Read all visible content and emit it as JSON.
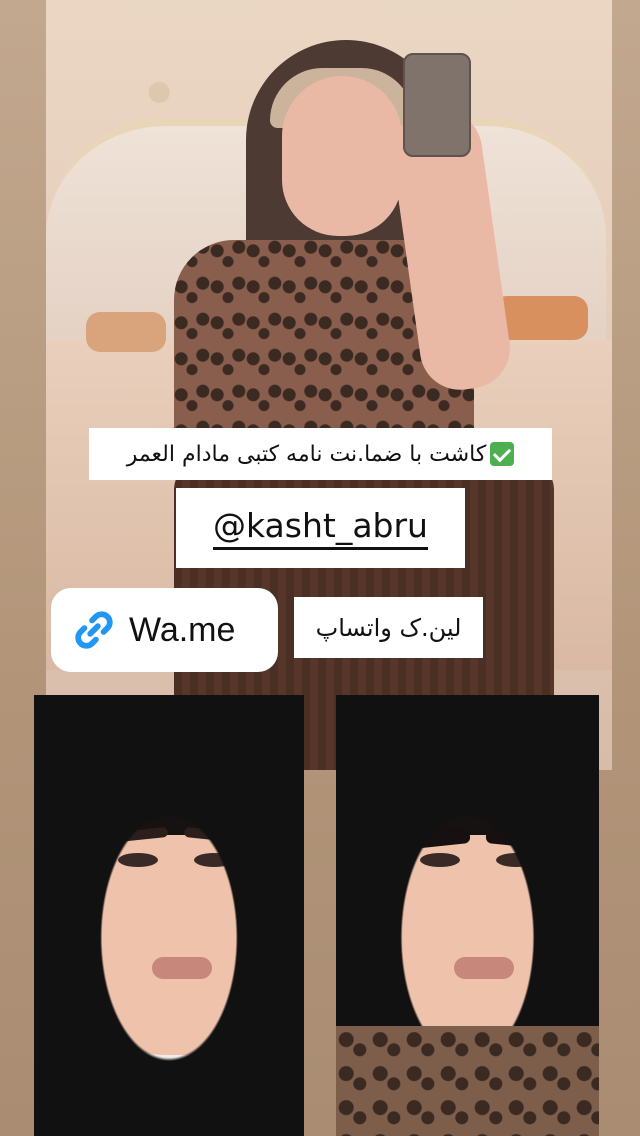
{
  "story": {
    "caption": {
      "check_emoji": "✅",
      "text": "کاشت با ضما.نت  نامه کتبی مادام العمر"
    },
    "mention": "@kasht_abru",
    "link_sticker": {
      "icon": "link-icon",
      "label": "Wa.me"
    },
    "whatsapp_label": "لین.ک واتساپ"
  },
  "colors": {
    "background": "#b59a7f",
    "sticker_bg": "#ffffff",
    "link_icon": "#2196f3",
    "check_green": "#4caf50"
  }
}
